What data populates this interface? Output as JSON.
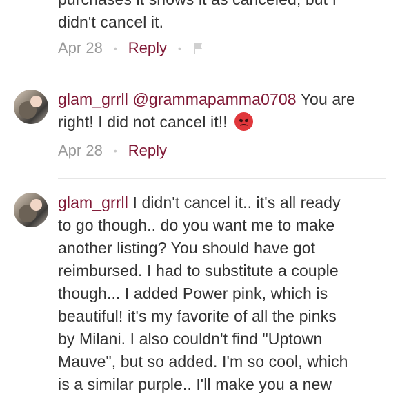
{
  "comments": [
    {
      "text_cut": "purchases it shows it as canceled, but I",
      "text_last": "didn't  cancel it.",
      "date": "Apr 28",
      "reply": "Reply"
    },
    {
      "username": "glam_grrll",
      "mention": "@grammapamma0708",
      "text_a": " You are",
      "text_b": "right! I did not cancel it!!",
      "date": "Apr 28",
      "reply": "Reply"
    },
    {
      "username": "glam_grrll",
      "line1": " I didn't cancel it.. it's all ready",
      "line2": "to go though.. do you want me to make",
      "line3": "another listing? You should have got",
      "line4": "reimbursed. I had to substitute a couple",
      "line5": "though... I added Power pink, which is",
      "line6": "beautiful! it's my favorite of all the pinks",
      "line7": "by Milani. I also couldn't find \"Uptown",
      "line8": "Mauve\", but so added. I'm so cool, which",
      "line9": "is a similar purple.. I'll make you a new"
    }
  ],
  "icons": {
    "flag": "flag-icon",
    "emoji": "angry-face-emoji"
  },
  "colors": {
    "accent": "#7f1734",
    "muted": "#999999",
    "text": "#333333"
  }
}
